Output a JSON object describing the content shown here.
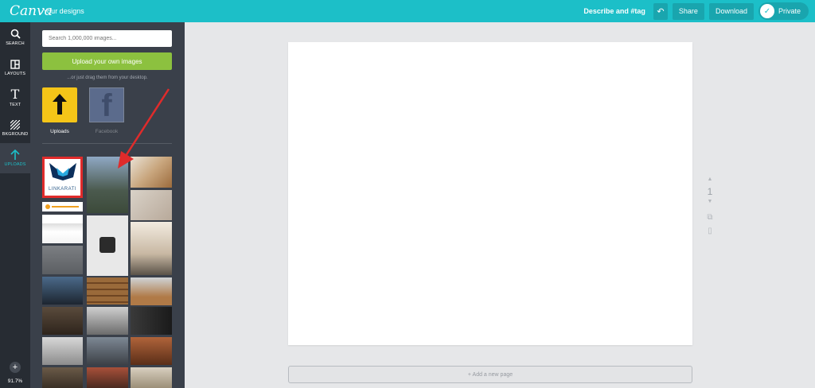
{
  "topbar": {
    "logo": "Canva",
    "nav_link": "Your designs",
    "doc_title": "Describe and #tag",
    "share": "Share",
    "download": "Download",
    "privacy": "Private",
    "color": "#1cbfc8"
  },
  "leftnav": {
    "items": [
      {
        "label": "SEARCH",
        "icon": "search-icon"
      },
      {
        "label": "LAYOUTS",
        "icon": "layouts-icon"
      },
      {
        "label": "TEXT",
        "icon": "text-icon"
      },
      {
        "label": "BKGROUND",
        "icon": "background-icon"
      },
      {
        "label": "UPLOADS",
        "icon": "upload-arrow-icon",
        "active": true
      }
    ],
    "add": "+",
    "zoom": "91.7%"
  },
  "panel": {
    "search_placeholder": "Search 1,000,000 images...",
    "upload_button": "Upload your own images",
    "drag_hint": "...or just drag them from your desktop.",
    "sources": [
      {
        "label": "Uploads",
        "active": true
      },
      {
        "label": "Facebook",
        "active": false
      }
    ],
    "logo_wordmark": "LINKARATI",
    "highlight_color": "#e02b2b"
  },
  "canvas": {
    "page_number": "1",
    "add_page": "+ Add a new page"
  }
}
